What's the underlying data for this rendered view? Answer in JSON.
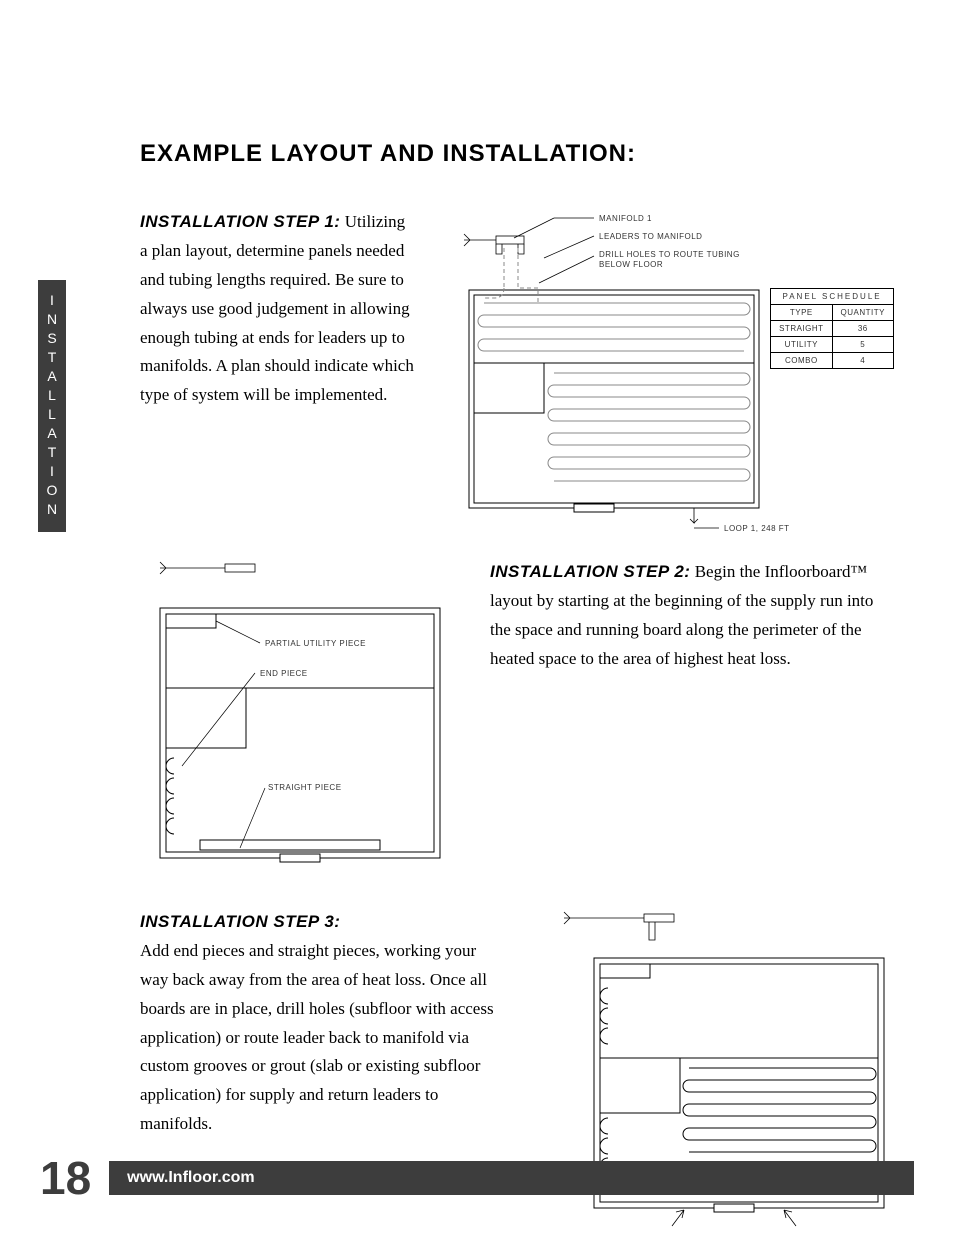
{
  "side_tab": "INSTALLATION",
  "title": "EXAMPLE LAYOUT AND INSTALLATION:",
  "step1": {
    "label": "INSTALLATION STEP 1:",
    "text": " Utilizing a plan layout, determine panels needed and tubing lengths required.  Be sure to always use good judgement in allowing enough tubing at ends for leaders up to manifolds.  A plan should indicate which type of system will be implemented."
  },
  "fig1": {
    "callouts": {
      "manifold": "MANIFOLD 1",
      "leaders": "LEADERS TO MANIFOLD",
      "drill": "DRILL HOLES TO ROUTE TUBING BELOW FLOOR",
      "loop": "LOOP 1, 248 FT"
    },
    "panel_schedule": {
      "title": "PANEL SCHEDULE",
      "headers": [
        "TYPE",
        "QUANTITY"
      ],
      "rows": [
        [
          "STRAIGHT",
          "36"
        ],
        [
          "UTILITY",
          "5"
        ],
        [
          "COMBO",
          "4"
        ]
      ]
    }
  },
  "step2": {
    "label": "INSTALLATION STEP 2:",
    "text": " Begin the Infloorboard™ layout by starting at the beginning of the supply run into the space and running board along the perimeter of the heated space to the area of highest heat loss."
  },
  "fig2": {
    "callouts": {
      "partial": "PARTIAL UTILITY PIECE",
      "end": "END PIECE",
      "straight": "STRAIGHT PIECE"
    }
  },
  "step3": {
    "label": "INSTALLATION STEP 3:",
    "text": "Add end pieces and straight pieces, working your way back away from the area of heat loss.  Once all boards are in place, drill holes (subfloor with access application) or route leader back to manifold via custom grooves or grout (slab or existing subfloor application) for supply and return leaders to manifolds."
  },
  "footer": {
    "page": "18",
    "url": "www.Infloor.com"
  }
}
